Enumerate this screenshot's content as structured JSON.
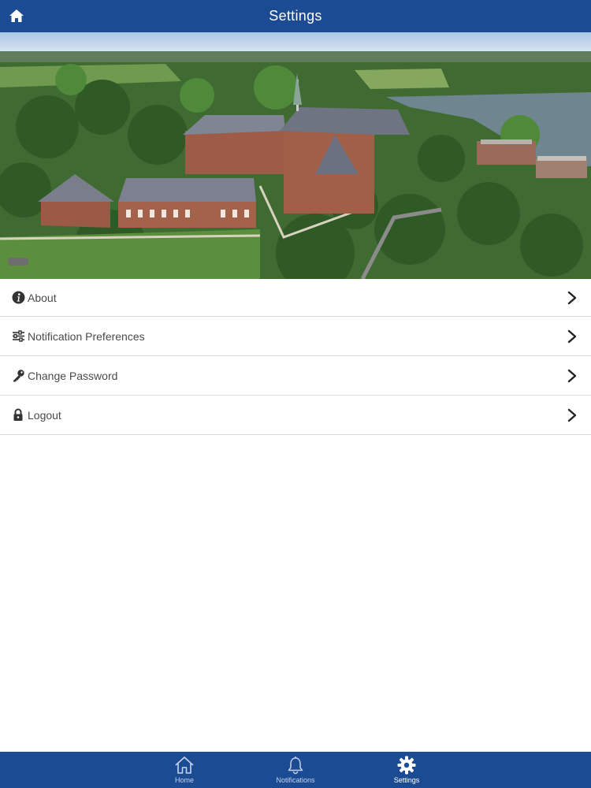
{
  "header": {
    "title": "Settings",
    "home_icon": "home-icon"
  },
  "menu": {
    "items": [
      {
        "label": "About",
        "icon": "info-icon"
      },
      {
        "label": "Notification Preferences",
        "icon": "sliders-icon"
      },
      {
        "label": "Change Password",
        "icon": "key-icon"
      },
      {
        "label": "Logout",
        "icon": "lock-icon"
      }
    ]
  },
  "tabbar": {
    "tabs": [
      {
        "label": "Home",
        "icon": "house-icon",
        "active": false
      },
      {
        "label": "Notifications",
        "icon": "bell-icon",
        "active": false
      },
      {
        "label": "Settings",
        "icon": "gear-icon",
        "active": true
      }
    ]
  },
  "colors": {
    "brand": "#1b4b93",
    "divider": "#dadada",
    "text": "#4a4a4a"
  }
}
